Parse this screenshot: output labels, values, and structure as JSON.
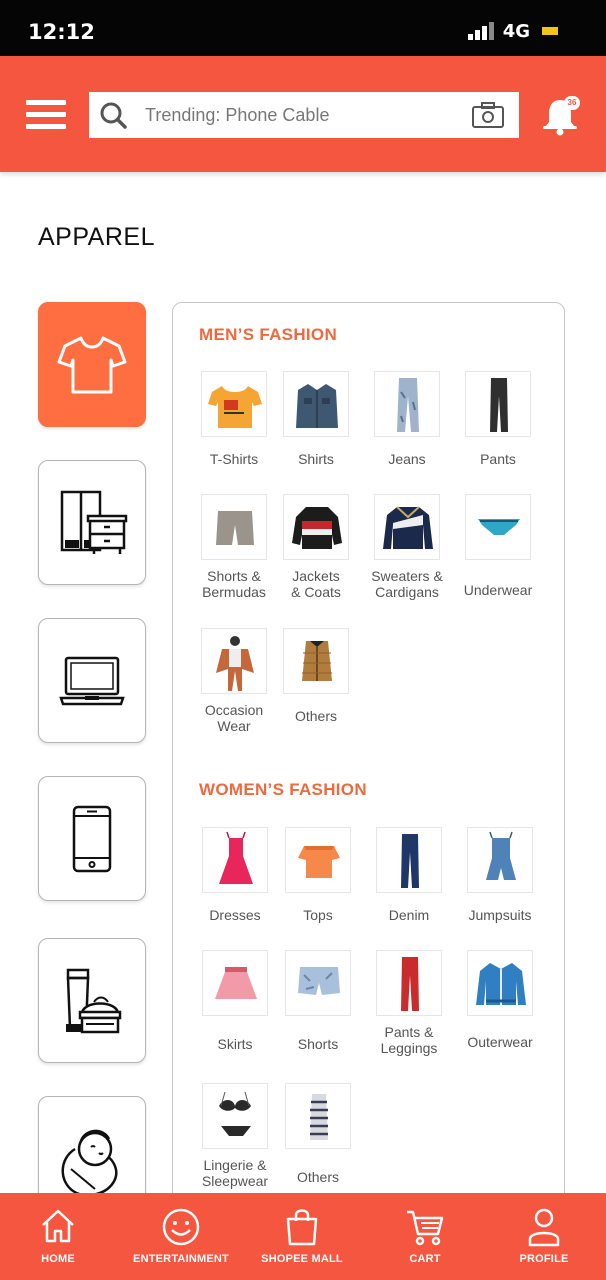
{
  "status_bar": {
    "time": "12:12",
    "network": "4G"
  },
  "header": {
    "search_placeholder": "Trending: Phone Cable",
    "notification_count": "36"
  },
  "page": {
    "title": "APPAREL"
  },
  "categories": [
    {
      "icon": "tshirt-icon",
      "active": true
    },
    {
      "icon": "furniture-icon",
      "active": false
    },
    {
      "icon": "laptop-icon",
      "active": false
    },
    {
      "icon": "smartphone-icon",
      "active": false
    },
    {
      "icon": "cosmetics-icon",
      "active": false
    },
    {
      "icon": "baby-icon",
      "active": false
    }
  ],
  "mens": {
    "title": "MEN’S FASHION",
    "items": [
      {
        "label": "T-Shirts"
      },
      {
        "label": "Shirts"
      },
      {
        "label": "Jeans"
      },
      {
        "label": "Pants"
      },
      {
        "label": "Shorts &\nBermudas"
      },
      {
        "label": "Jackets\n& Coats"
      },
      {
        "label": "Sweaters &\nCardigans"
      },
      {
        "label": "Underwear"
      },
      {
        "label": "Occasion\nWear"
      },
      {
        "label": "Others"
      }
    ]
  },
  "womens": {
    "title": "WOMEN’S FASHION",
    "items": [
      {
        "label": "Dresses"
      },
      {
        "label": "Tops"
      },
      {
        "label": "Denim"
      },
      {
        "label": "Jumpsuits"
      },
      {
        "label": "Skirts"
      },
      {
        "label": "Shorts"
      },
      {
        "label": "Pants &\nLeggings"
      },
      {
        "label": "Outerwear"
      },
      {
        "label": "Lingerie &\nSleepwear"
      },
      {
        "label": "Others"
      }
    ]
  },
  "bottom_nav": [
    {
      "label": "HOME",
      "icon": "home-icon"
    },
    {
      "label": "ENTERTAINMENT",
      "icon": "smiley-icon"
    },
    {
      "label": "SHOPEE MALL",
      "icon": "shopping-bag-icon"
    },
    {
      "label": "CART",
      "icon": "cart-icon"
    },
    {
      "label": "PROFILE",
      "icon": "profile-icon"
    }
  ],
  "colors": {
    "brand": "#f5563f",
    "active_category": "#ff6e40",
    "section_title": "#ee6a3e"
  }
}
